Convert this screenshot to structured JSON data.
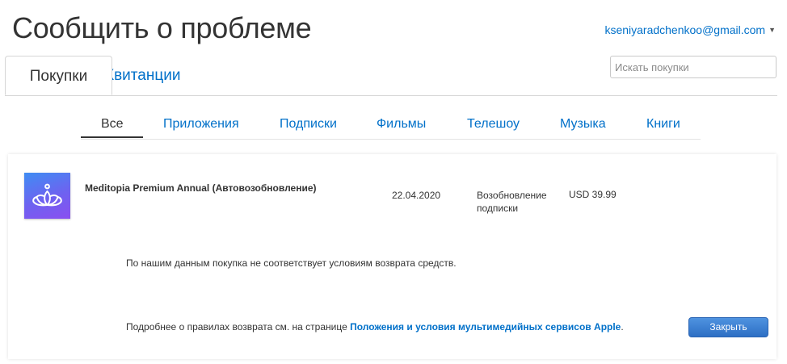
{
  "header": {
    "title": "Сообщить о проблеме",
    "account_email": "kseniyaradchenkoo@gmail.com"
  },
  "tabs": {
    "purchases": "Покупки",
    "receipts": "Квитанции"
  },
  "search": {
    "placeholder": "Искать покупки",
    "value": ""
  },
  "filters": [
    "Все",
    "Приложения",
    "Подписки",
    "Фильмы",
    "Телешоу",
    "Музыка",
    "Книги"
  ],
  "active_filter": "Все",
  "purchase": {
    "title": "Meditopia Premium Annual (Автовозобновление)",
    "date": "22.04.2020",
    "type_line1": "Возобновление",
    "type_line2": "подписки",
    "price": "USD 39.99",
    "icon": "meditopia-lotus-icon"
  },
  "refund": {
    "message": "По нашим данным покупка не соответствует условиям возврата средств.",
    "policy_prefix": "Подробнее о правилах возврата см. на странице ",
    "policy_link": "Положения и условия мультимедийных сервисов Apple",
    "policy_suffix": ".",
    "close_label": "Закрыть"
  },
  "colors": {
    "link": "#0070c9",
    "button": "#3a7fd5",
    "icon_gradient_start": "#3f8df3",
    "icon_gradient_end": "#8a4ff0"
  }
}
